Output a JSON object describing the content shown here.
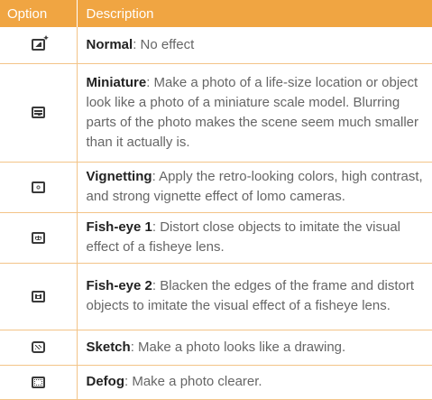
{
  "table": {
    "headers": {
      "option": "Option",
      "description": "Description"
    },
    "rows": [
      {
        "icon": "normal-filter-icon",
        "name": "Normal",
        "text": ": No effect"
      },
      {
        "icon": "miniature-filter-icon",
        "name": "Miniature",
        "text": ": Make a photo of a life-size location or object look like a photo of a miniature scale model. Blurring parts of the photo makes the scene seem much smaller than it actually is."
      },
      {
        "icon": "vignetting-filter-icon",
        "name": "Vignetting",
        "text": ": Apply the retro-looking colors, high contrast, and strong vignette effect of lomo cameras."
      },
      {
        "icon": "fisheye1-filter-icon",
        "name": "Fish-eye 1",
        "text": ": Distort close objects to imitate the visual effect of a fisheye lens."
      },
      {
        "icon": "fisheye2-filter-icon",
        "name": "Fish-eye 2",
        "text": ": Blacken the edges of the frame and distort objects to imitate the visual effect of a fisheye lens."
      },
      {
        "icon": "sketch-filter-icon",
        "name": "Sketch",
        "text": ": Make a photo looks like a drawing."
      },
      {
        "icon": "defog-filter-icon",
        "name": "Defog",
        "text": ": Make a photo clearer."
      }
    ]
  },
  "colors": {
    "header_bg": "#f0a542",
    "rule": "#f3c488",
    "body_text": "#666666",
    "bold_text": "#222222"
  }
}
